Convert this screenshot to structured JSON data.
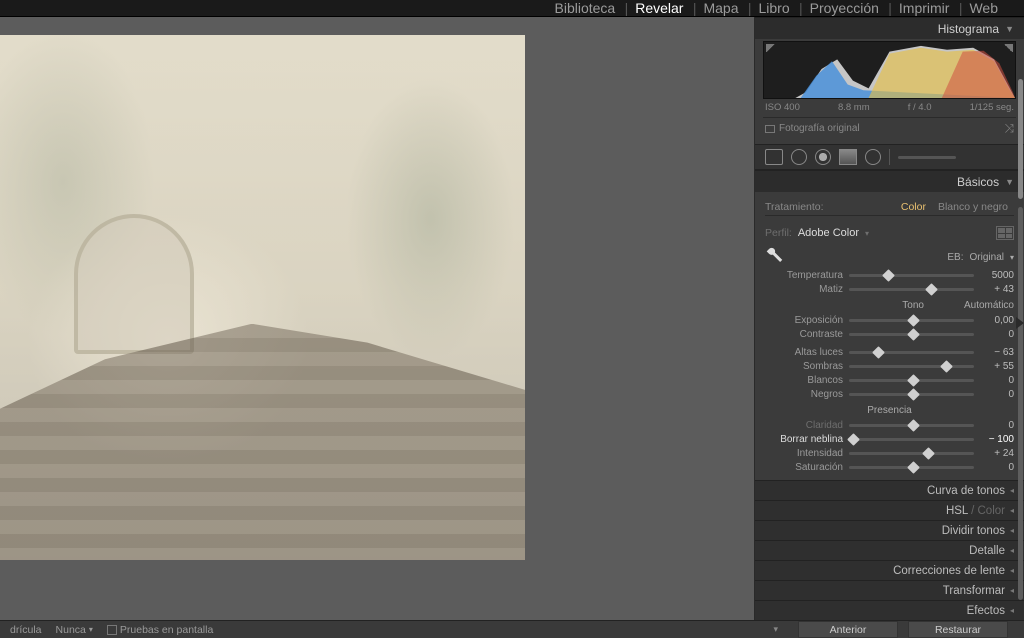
{
  "modules": {
    "library": "Biblioteca",
    "develop": "Revelar",
    "map": "Mapa",
    "book": "Libro",
    "slideshow": "Proyección",
    "print": "Imprimir",
    "web": "Web"
  },
  "histogram": {
    "title": "Histograma",
    "iso": "ISO 400",
    "focal": "8.8 mm",
    "aperture": "f / 4.0",
    "shutter": "1/125 seg.",
    "original_label": "Fotografía original"
  },
  "basics": {
    "title": "Básicos",
    "treatment_label": "Tratamiento:",
    "treatment_color": "Color",
    "treatment_bw": "Blanco y negro",
    "profile_label": "Perfil:",
    "profile_value": "Adobe Color",
    "wb_label": "EB:",
    "wb_value": "Original",
    "temp_label": "Temperatura",
    "temp_value": "5000",
    "tint_label": "Matiz",
    "tint_value": "+ 43",
    "tone_head": "Tono",
    "auto_label": "Automático",
    "exposure_label": "Exposición",
    "exposure_value": "0,00",
    "contrast_label": "Contraste",
    "contrast_value": "0",
    "highlights_label": "Altas luces",
    "highlights_value": "− 63",
    "shadows_label": "Sombras",
    "shadows_value": "+ 55",
    "whites_label": "Blancos",
    "whites_value": "0",
    "blacks_label": "Negros",
    "blacks_value": "0",
    "presence_head": "Presencia",
    "clarity_label": "Claridad",
    "clarity_value": "0",
    "dehaze_label": "Borrar neblina",
    "dehaze_value": "− 100",
    "vibrance_label": "Intensidad",
    "vibrance_value": "+ 24",
    "saturation_label": "Saturación",
    "saturation_value": "0"
  },
  "panels": {
    "tone_curve": "Curva de tonos",
    "hsl": "HSL",
    "hsl_color": " / Color",
    "split": "Dividir tonos",
    "detail": "Detalle",
    "lens": "Correcciones de lente",
    "transform": "Transformar",
    "effects": "Efectos"
  },
  "footer": {
    "grid_label": "drícula",
    "nunca": "Nunca",
    "soft_proof": "Pruebas en pantalla",
    "prev_btn": "Anterior",
    "reset_btn": "Restaurar"
  }
}
